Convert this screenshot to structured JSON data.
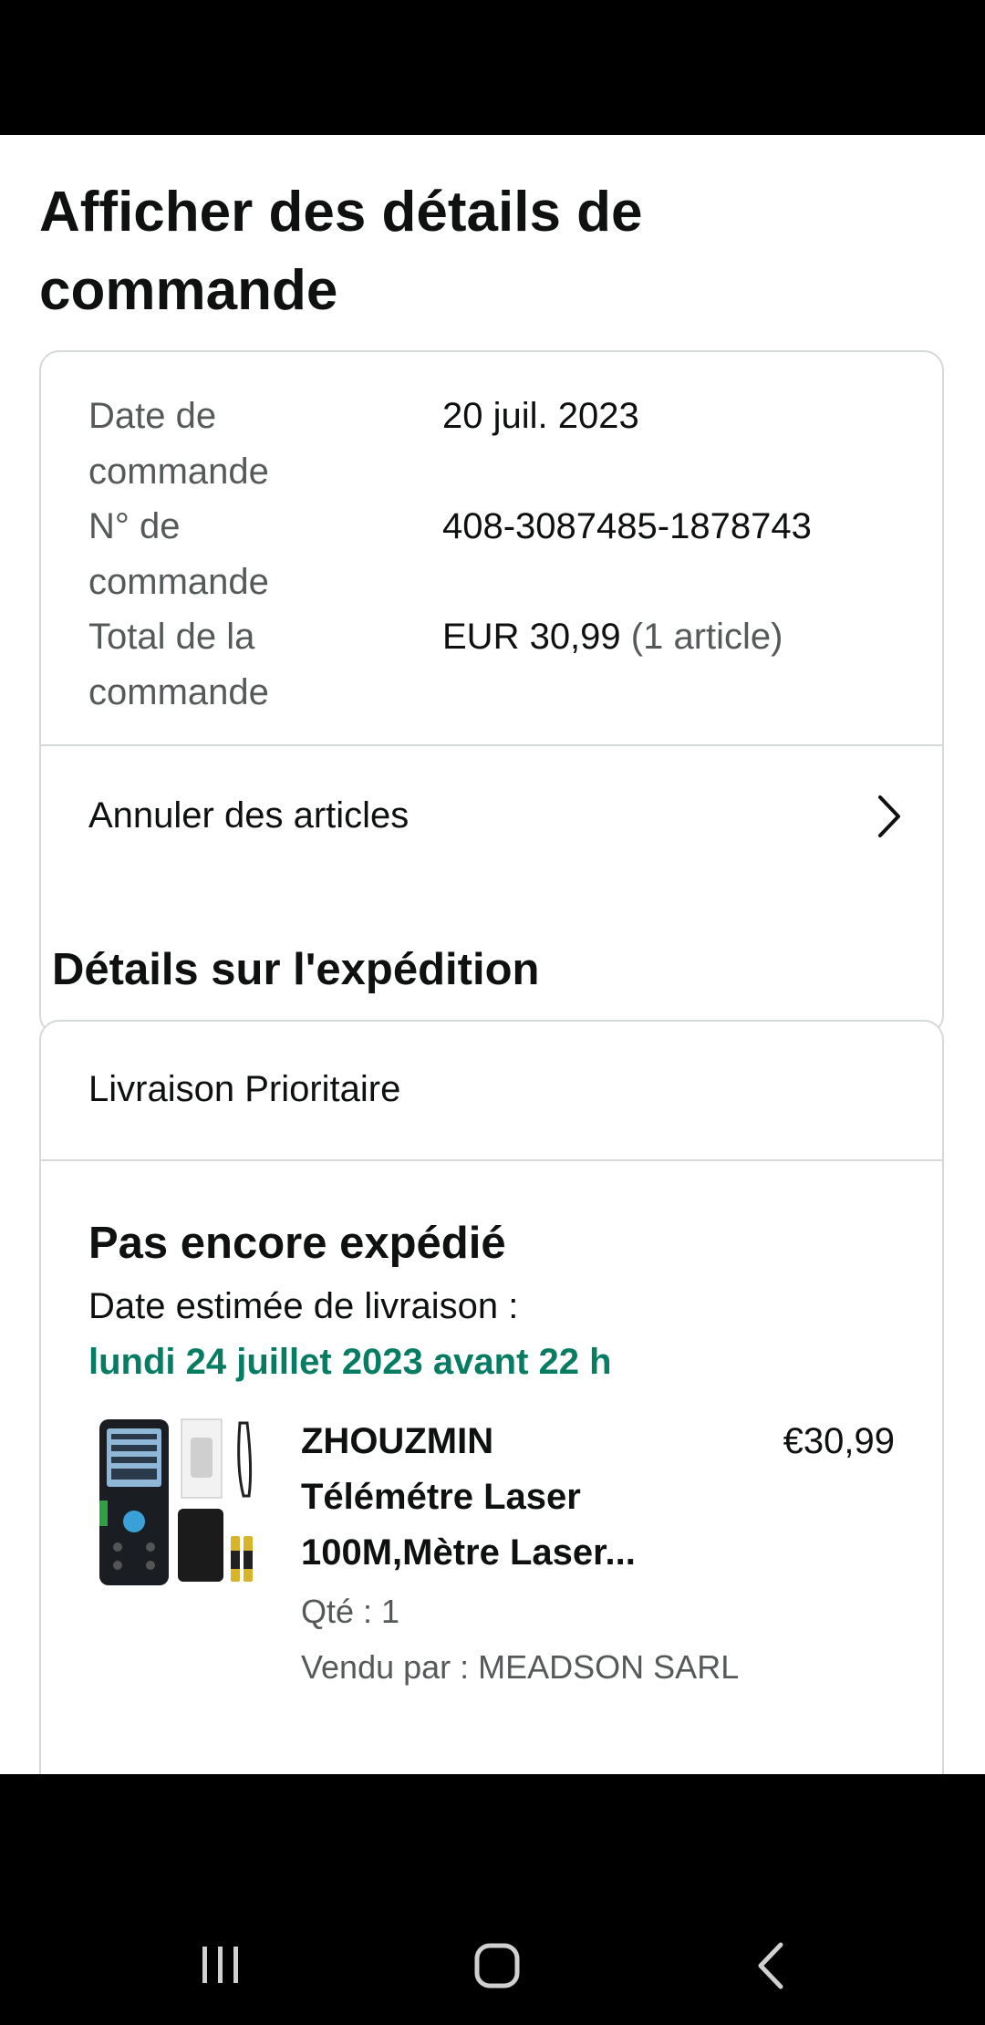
{
  "page": {
    "title": "Afficher des détails de commande"
  },
  "summary": {
    "rows": [
      {
        "label": "Date de commande",
        "value": "20 juil. 2023"
      },
      {
        "label": "N° de commande",
        "value": "408-3087485-1878743"
      },
      {
        "label": "Total de la commande",
        "value": "EUR 30,99",
        "value_extra": "(1 article)"
      }
    ],
    "cancel_label": "Annuler des articles"
  },
  "shipping": {
    "section_title": "Détails sur l'expédition",
    "method": "Livraison Prioritaire",
    "status": "Pas encore expédié",
    "estimate_label": "Date estimée de livraison :",
    "estimate_date": "lundi 24 juillet 2023 avant 22 h",
    "estimate_color": "#067d62"
  },
  "product": {
    "title_line1": "ZHOUZMIN",
    "title_line2": "Télémétre Laser",
    "title_line3": "100M,Mètre Laser...",
    "price": "€30,99",
    "qty": "Qté : 1",
    "seller": "Vendu par : MEADSON SARL",
    "image_icon": "laser-rangefinder-product-image"
  },
  "navbar": {
    "icons": [
      "recent-apps-icon",
      "home-icon",
      "back-icon"
    ]
  }
}
